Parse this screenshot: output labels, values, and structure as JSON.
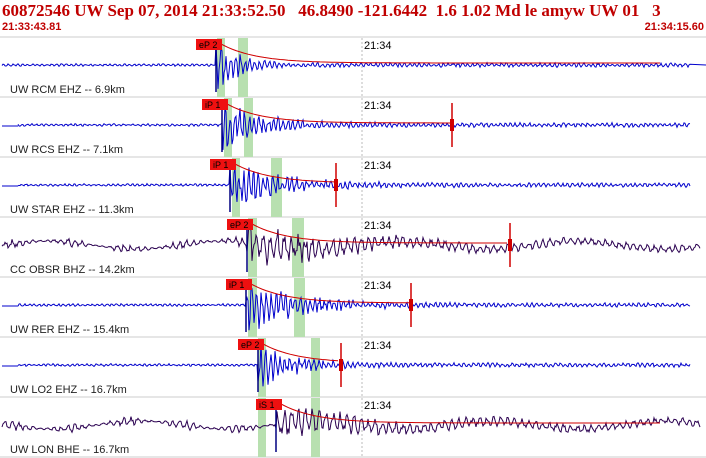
{
  "header": {
    "title": "60872546 UW Sep 07, 2014 21:33:52.50   46.8490 -121.6442  1.6 1.02 Md le amyw UW 01   3",
    "start_time": "21:33:43.81",
    "end_time": "21:34:15.60"
  },
  "colors": {
    "header_text": "#c00000",
    "trace_blue": "#0000cc",
    "trace_purple": "#2a0050",
    "coda_red": "#d00000",
    "pick_box": "#ee1010",
    "window_green": "#b8e0b0",
    "grid": "#cccccc"
  },
  "traces": [
    {
      "label": "UW RCM EHZ -- 6.9km",
      "pick": "eP 2",
      "time_label": "21:34",
      "color": "blue"
    },
    {
      "label": "UW RCS EHZ -- 7.1km",
      "pick": "iP 1",
      "time_label": "21:34",
      "color": "blue"
    },
    {
      "label": "UW STAR EHZ -- 11.3km",
      "pick": "iP 1",
      "time_label": "21:34",
      "color": "blue"
    },
    {
      "label": "CC OBSR BHZ -- 14.2km",
      "pick": "eP 2",
      "time_label": "21:34",
      "color": "purple"
    },
    {
      "label": "UW RER EHZ -- 15.4km",
      "pick": "iP 1",
      "time_label": "21:34",
      "color": "blue"
    },
    {
      "label": "UW LO2 EHZ -- 16.7km",
      "pick": "eP 2",
      "time_label": "21:34",
      "color": "blue"
    },
    {
      "label": "UW LON BHE -- 16.7km",
      "pick": "iS 1",
      "time_label": "21:34",
      "color": "purple"
    }
  ]
}
